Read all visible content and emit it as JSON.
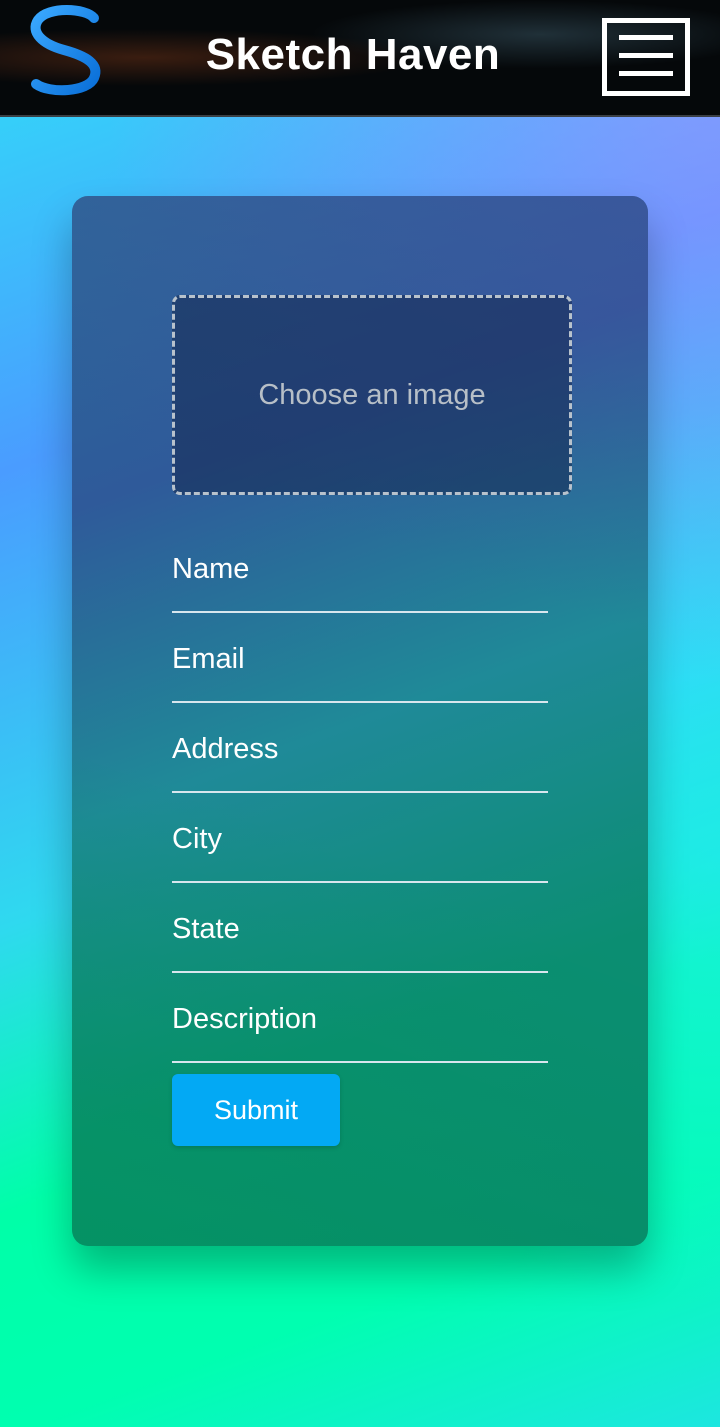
{
  "header": {
    "title": "Sketch Haven",
    "logo_icon": "s-logo-icon",
    "menu_icon": "hamburger-menu-icon"
  },
  "form": {
    "upload_label": "Choose an image",
    "fields": {
      "name": "Name",
      "email": "Email",
      "address": "Address",
      "city": "City",
      "state": "State",
      "description": "Description"
    },
    "submit_label": "Submit"
  },
  "colors": {
    "accent": "#03a9f4",
    "header_bg": "#05080a",
    "logo_blue": "#1a8cff"
  }
}
